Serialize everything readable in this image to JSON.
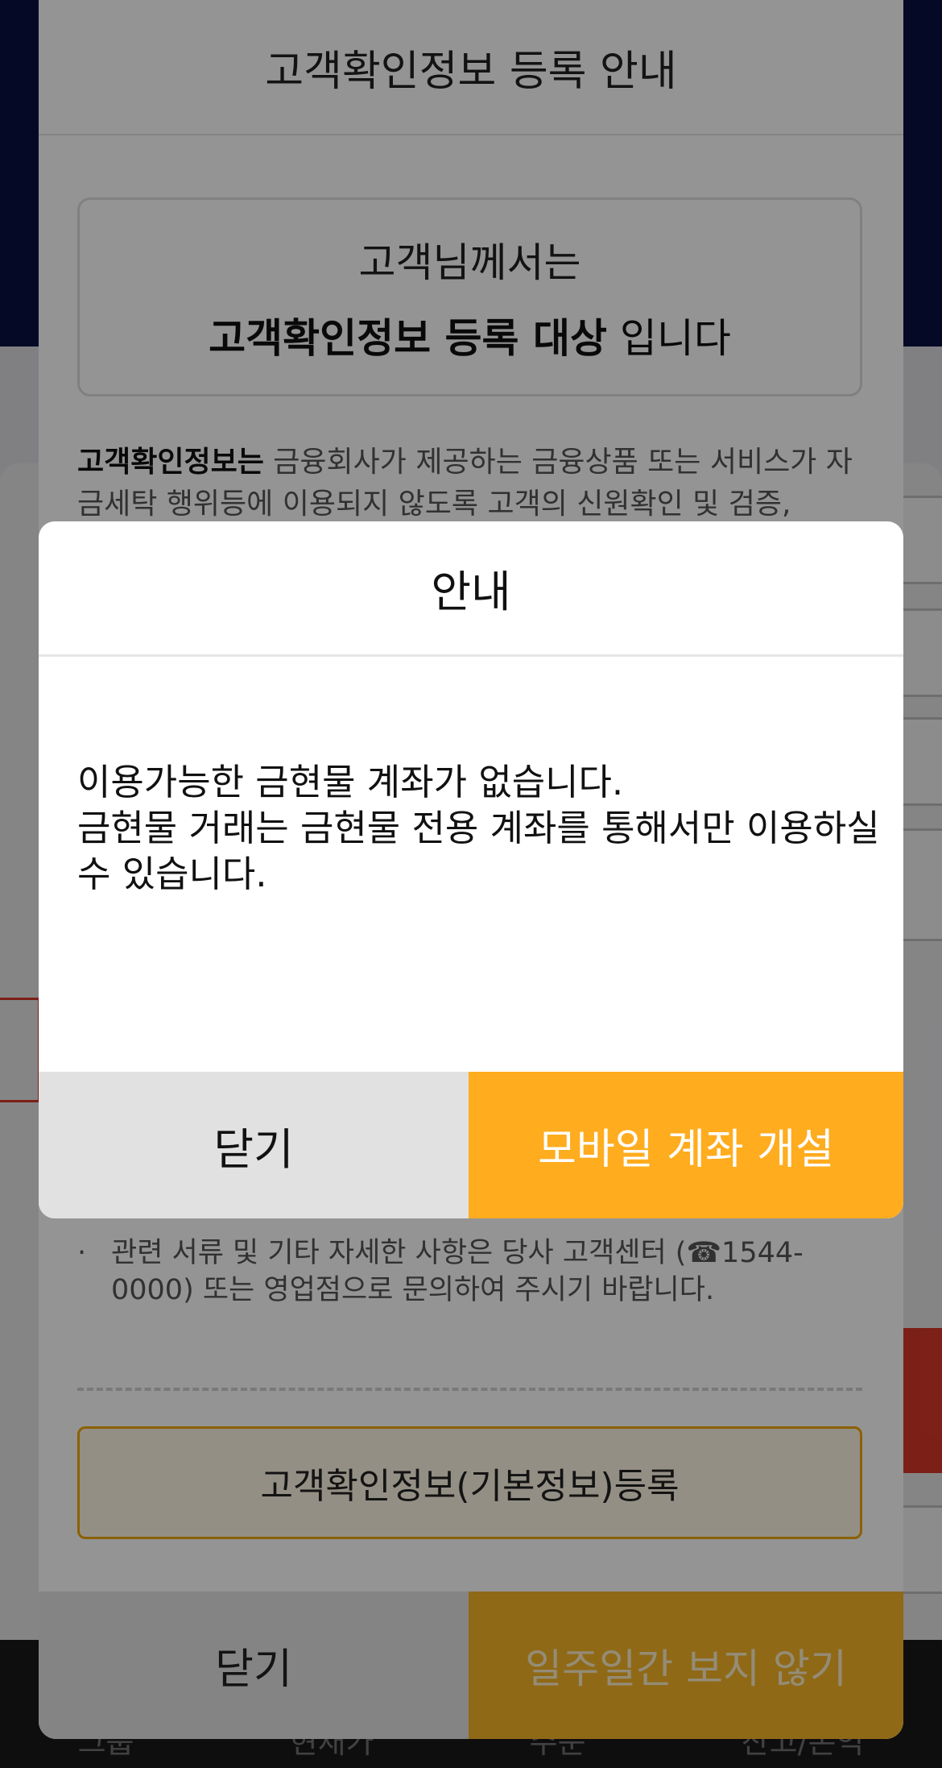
{
  "background_app": {
    "nav_items": [
      "그룹",
      "현재가",
      "주문",
      "잔고/손익"
    ]
  },
  "customer_info_dialog": {
    "title": "고객확인정보 등록 안내",
    "notice_line1": "고객님께서는",
    "notice_bold": "고객확인정보 등록 대상",
    "notice_suffix": " 입니다",
    "desc_bold": "고객확인정보는",
    "desc_text": " 금융회사가 제공하는 금융상품 또는 서비스가 자금세탁 행위등에 이용되지 않도록 고객의 신원확인 및 검증,",
    "contact_text": "관련 서류 및 기타 자세한 사항은 당사 고객센터 (☎1544-0000) 또는 영업점으로 문의하여 주시기 바랍니다.",
    "register_button": "고객확인정보(기본정보)등록",
    "close_button": "닫기",
    "hide_week_button": "일주일간 보지 않기"
  },
  "alert": {
    "title": "안내",
    "message_line1": "이용가능한 금현물 계좌가 없습니다.",
    "message_line2": "금현물 거래는 금현물 전용 계좌를 통해서만 이용하실 수 있습니다.",
    "close_button": "닫기",
    "open_account_button": "모바일 계좌 개설"
  },
  "colors": {
    "accent": "#ffac1e",
    "close_bg": "#e1e1e1",
    "register_border": "#f0a800"
  }
}
